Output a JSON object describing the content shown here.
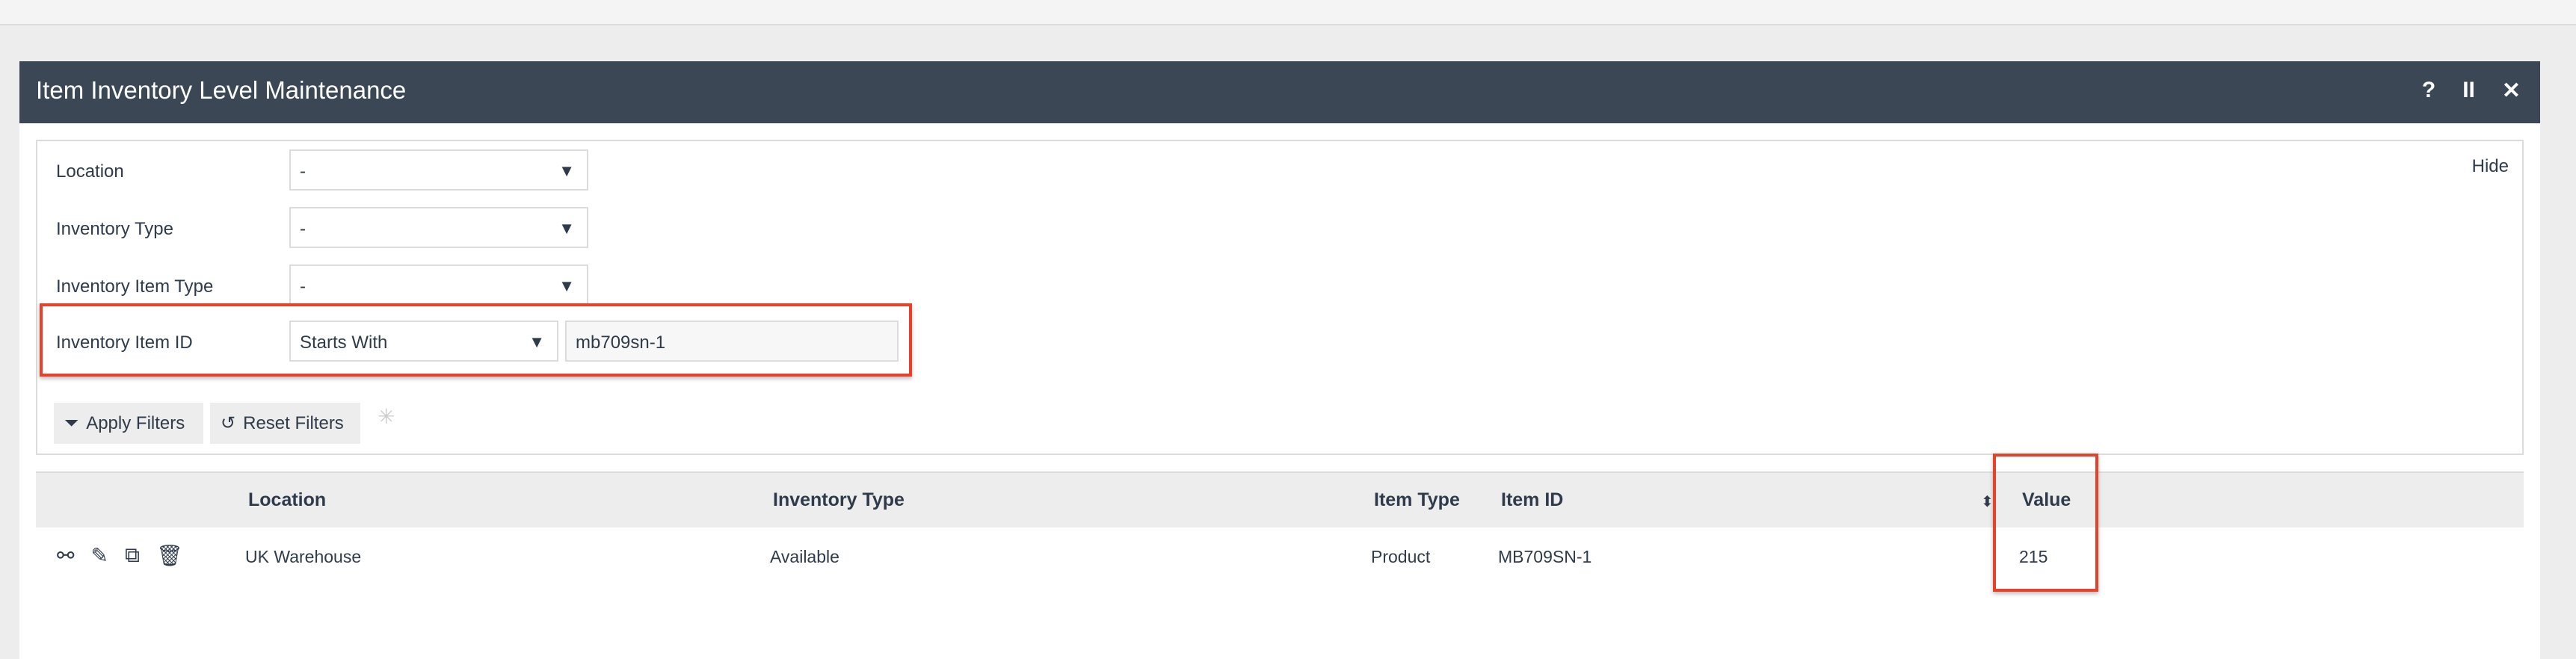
{
  "window": {
    "title": "Item Inventory Level Maintenance",
    "help": "?",
    "pause": "II",
    "close": "✕"
  },
  "filters": {
    "hide_label": "Hide",
    "location": {
      "label": "Location",
      "value": "-"
    },
    "inventory_type": {
      "label": "Inventory Type",
      "value": "-"
    },
    "inventory_item_type": {
      "label": "Inventory Item Type",
      "value": "-"
    },
    "inventory_item_id": {
      "label": "Inventory Item ID",
      "operator": "Starts With",
      "value": "mb709sn-1"
    },
    "apply_label": "Apply Filters",
    "reset_label": "Reset Filters"
  },
  "table": {
    "columns": [
      "Location",
      "Inventory Type",
      "Item Type",
      "Item ID",
      "Value"
    ],
    "rows": [
      {
        "location": "UK Warehouse",
        "inventory_type": "Available",
        "item_type": "Product",
        "item_id": "MB709SN-1",
        "value": "215"
      }
    ]
  },
  "colors": {
    "header": "#3b4754",
    "highlight": "#e8412a"
  }
}
